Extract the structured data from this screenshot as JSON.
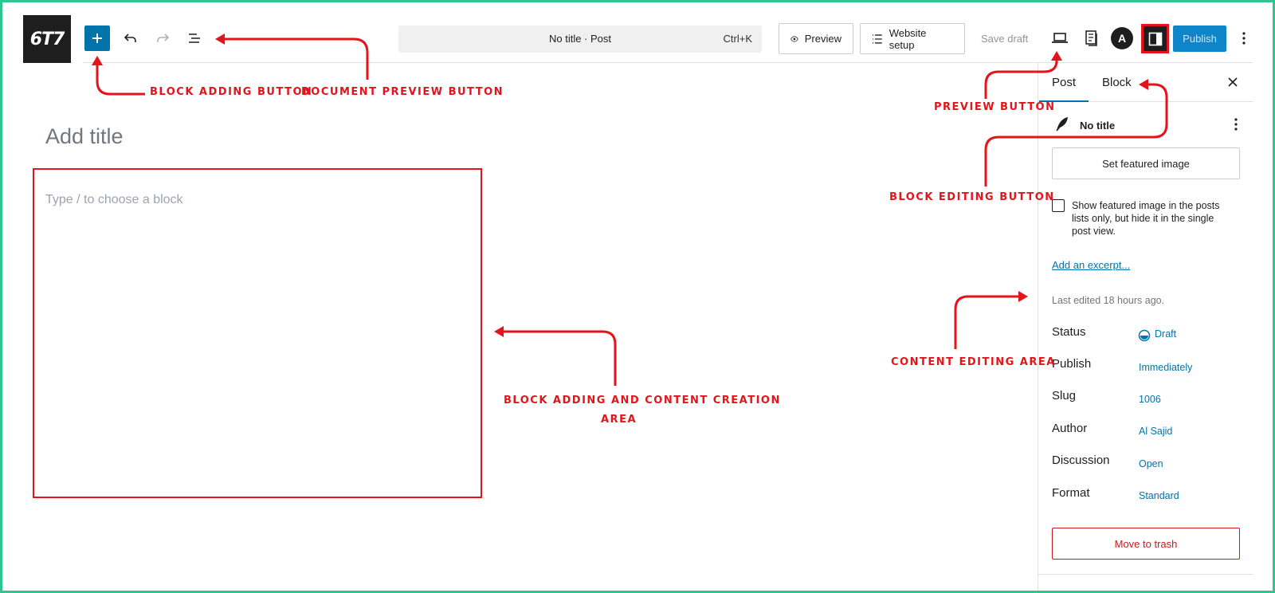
{
  "logo": {
    "text": "6T7"
  },
  "toolbar": {
    "command_title": "No title · Post",
    "command_shortcut": "Ctrl+K",
    "preview_label": "Preview",
    "website_setup_label": "Website setup",
    "save_draft_label": "Save draft",
    "publish_label": "Publish",
    "astra_letter": "A"
  },
  "editor": {
    "title_placeholder": "Add title",
    "block_placeholder": "Type / to choose a block"
  },
  "sidebar": {
    "tabs": [
      {
        "label": "Post"
      },
      {
        "label": "Block"
      }
    ],
    "post_title": "No title",
    "featured_image_label": "Set featured image",
    "featured_checkbox_label": "Show featured image in the posts lists only, but hide it in the single post view.",
    "excerpt_label": "Add an excerpt...",
    "last_edited": "Last edited 18 hours ago.",
    "meta": [
      {
        "label": "Status",
        "value": "Draft"
      },
      {
        "label": "Publish",
        "value": "Immediately"
      },
      {
        "label": "Slug",
        "value": "1006"
      },
      {
        "label": "Author",
        "value": "Al Sajid"
      },
      {
        "label": "Discussion",
        "value": "Open"
      },
      {
        "label": "Format",
        "value": "Standard"
      }
    ],
    "trash_label": "Move to trash"
  },
  "annotations": {
    "block_adding_button": "Block adding button",
    "document_preview_button": "Document preview button",
    "preview_button": "Preview button",
    "block_editing_button": "Block editing button",
    "content_editing_area": "Content editing area",
    "block_content_area_line1": "Block adding and content creation",
    "block_content_area_line2": "area"
  },
  "colors": {
    "accent": "#0073aa",
    "annotation_red": "#e5131b",
    "frame_green": "#2ec58f",
    "trash_red": "#cc1818"
  }
}
